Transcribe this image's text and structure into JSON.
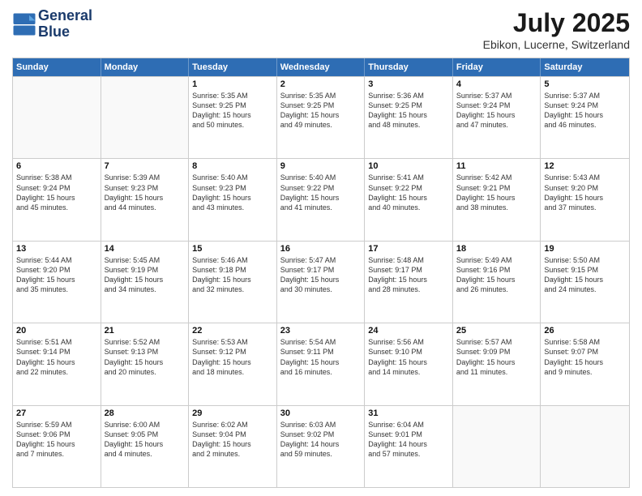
{
  "header": {
    "logo_line1": "General",
    "logo_line2": "Blue",
    "month_year": "July 2025",
    "location": "Ebikon, Lucerne, Switzerland"
  },
  "weekdays": [
    "Sunday",
    "Monday",
    "Tuesday",
    "Wednesday",
    "Thursday",
    "Friday",
    "Saturday"
  ],
  "weeks": [
    [
      {
        "day": "",
        "info": ""
      },
      {
        "day": "",
        "info": ""
      },
      {
        "day": "1",
        "info": "Sunrise: 5:35 AM\nSunset: 9:25 PM\nDaylight: 15 hours\nand 50 minutes."
      },
      {
        "day": "2",
        "info": "Sunrise: 5:35 AM\nSunset: 9:25 PM\nDaylight: 15 hours\nand 49 minutes."
      },
      {
        "day": "3",
        "info": "Sunrise: 5:36 AM\nSunset: 9:25 PM\nDaylight: 15 hours\nand 48 minutes."
      },
      {
        "day": "4",
        "info": "Sunrise: 5:37 AM\nSunset: 9:24 PM\nDaylight: 15 hours\nand 47 minutes."
      },
      {
        "day": "5",
        "info": "Sunrise: 5:37 AM\nSunset: 9:24 PM\nDaylight: 15 hours\nand 46 minutes."
      }
    ],
    [
      {
        "day": "6",
        "info": "Sunrise: 5:38 AM\nSunset: 9:24 PM\nDaylight: 15 hours\nand 45 minutes."
      },
      {
        "day": "7",
        "info": "Sunrise: 5:39 AM\nSunset: 9:23 PM\nDaylight: 15 hours\nand 44 minutes."
      },
      {
        "day": "8",
        "info": "Sunrise: 5:40 AM\nSunset: 9:23 PM\nDaylight: 15 hours\nand 43 minutes."
      },
      {
        "day": "9",
        "info": "Sunrise: 5:40 AM\nSunset: 9:22 PM\nDaylight: 15 hours\nand 41 minutes."
      },
      {
        "day": "10",
        "info": "Sunrise: 5:41 AM\nSunset: 9:22 PM\nDaylight: 15 hours\nand 40 minutes."
      },
      {
        "day": "11",
        "info": "Sunrise: 5:42 AM\nSunset: 9:21 PM\nDaylight: 15 hours\nand 38 minutes."
      },
      {
        "day": "12",
        "info": "Sunrise: 5:43 AM\nSunset: 9:20 PM\nDaylight: 15 hours\nand 37 minutes."
      }
    ],
    [
      {
        "day": "13",
        "info": "Sunrise: 5:44 AM\nSunset: 9:20 PM\nDaylight: 15 hours\nand 35 minutes."
      },
      {
        "day": "14",
        "info": "Sunrise: 5:45 AM\nSunset: 9:19 PM\nDaylight: 15 hours\nand 34 minutes."
      },
      {
        "day": "15",
        "info": "Sunrise: 5:46 AM\nSunset: 9:18 PM\nDaylight: 15 hours\nand 32 minutes."
      },
      {
        "day": "16",
        "info": "Sunrise: 5:47 AM\nSunset: 9:17 PM\nDaylight: 15 hours\nand 30 minutes."
      },
      {
        "day": "17",
        "info": "Sunrise: 5:48 AM\nSunset: 9:17 PM\nDaylight: 15 hours\nand 28 minutes."
      },
      {
        "day": "18",
        "info": "Sunrise: 5:49 AM\nSunset: 9:16 PM\nDaylight: 15 hours\nand 26 minutes."
      },
      {
        "day": "19",
        "info": "Sunrise: 5:50 AM\nSunset: 9:15 PM\nDaylight: 15 hours\nand 24 minutes."
      }
    ],
    [
      {
        "day": "20",
        "info": "Sunrise: 5:51 AM\nSunset: 9:14 PM\nDaylight: 15 hours\nand 22 minutes."
      },
      {
        "day": "21",
        "info": "Sunrise: 5:52 AM\nSunset: 9:13 PM\nDaylight: 15 hours\nand 20 minutes."
      },
      {
        "day": "22",
        "info": "Sunrise: 5:53 AM\nSunset: 9:12 PM\nDaylight: 15 hours\nand 18 minutes."
      },
      {
        "day": "23",
        "info": "Sunrise: 5:54 AM\nSunset: 9:11 PM\nDaylight: 15 hours\nand 16 minutes."
      },
      {
        "day": "24",
        "info": "Sunrise: 5:56 AM\nSunset: 9:10 PM\nDaylight: 15 hours\nand 14 minutes."
      },
      {
        "day": "25",
        "info": "Sunrise: 5:57 AM\nSunset: 9:09 PM\nDaylight: 15 hours\nand 11 minutes."
      },
      {
        "day": "26",
        "info": "Sunrise: 5:58 AM\nSunset: 9:07 PM\nDaylight: 15 hours\nand 9 minutes."
      }
    ],
    [
      {
        "day": "27",
        "info": "Sunrise: 5:59 AM\nSunset: 9:06 PM\nDaylight: 15 hours\nand 7 minutes."
      },
      {
        "day": "28",
        "info": "Sunrise: 6:00 AM\nSunset: 9:05 PM\nDaylight: 15 hours\nand 4 minutes."
      },
      {
        "day": "29",
        "info": "Sunrise: 6:02 AM\nSunset: 9:04 PM\nDaylight: 15 hours\nand 2 minutes."
      },
      {
        "day": "30",
        "info": "Sunrise: 6:03 AM\nSunset: 9:02 PM\nDaylight: 14 hours\nand 59 minutes."
      },
      {
        "day": "31",
        "info": "Sunrise: 6:04 AM\nSunset: 9:01 PM\nDaylight: 14 hours\nand 57 minutes."
      },
      {
        "day": "",
        "info": ""
      },
      {
        "day": "",
        "info": ""
      }
    ]
  ]
}
